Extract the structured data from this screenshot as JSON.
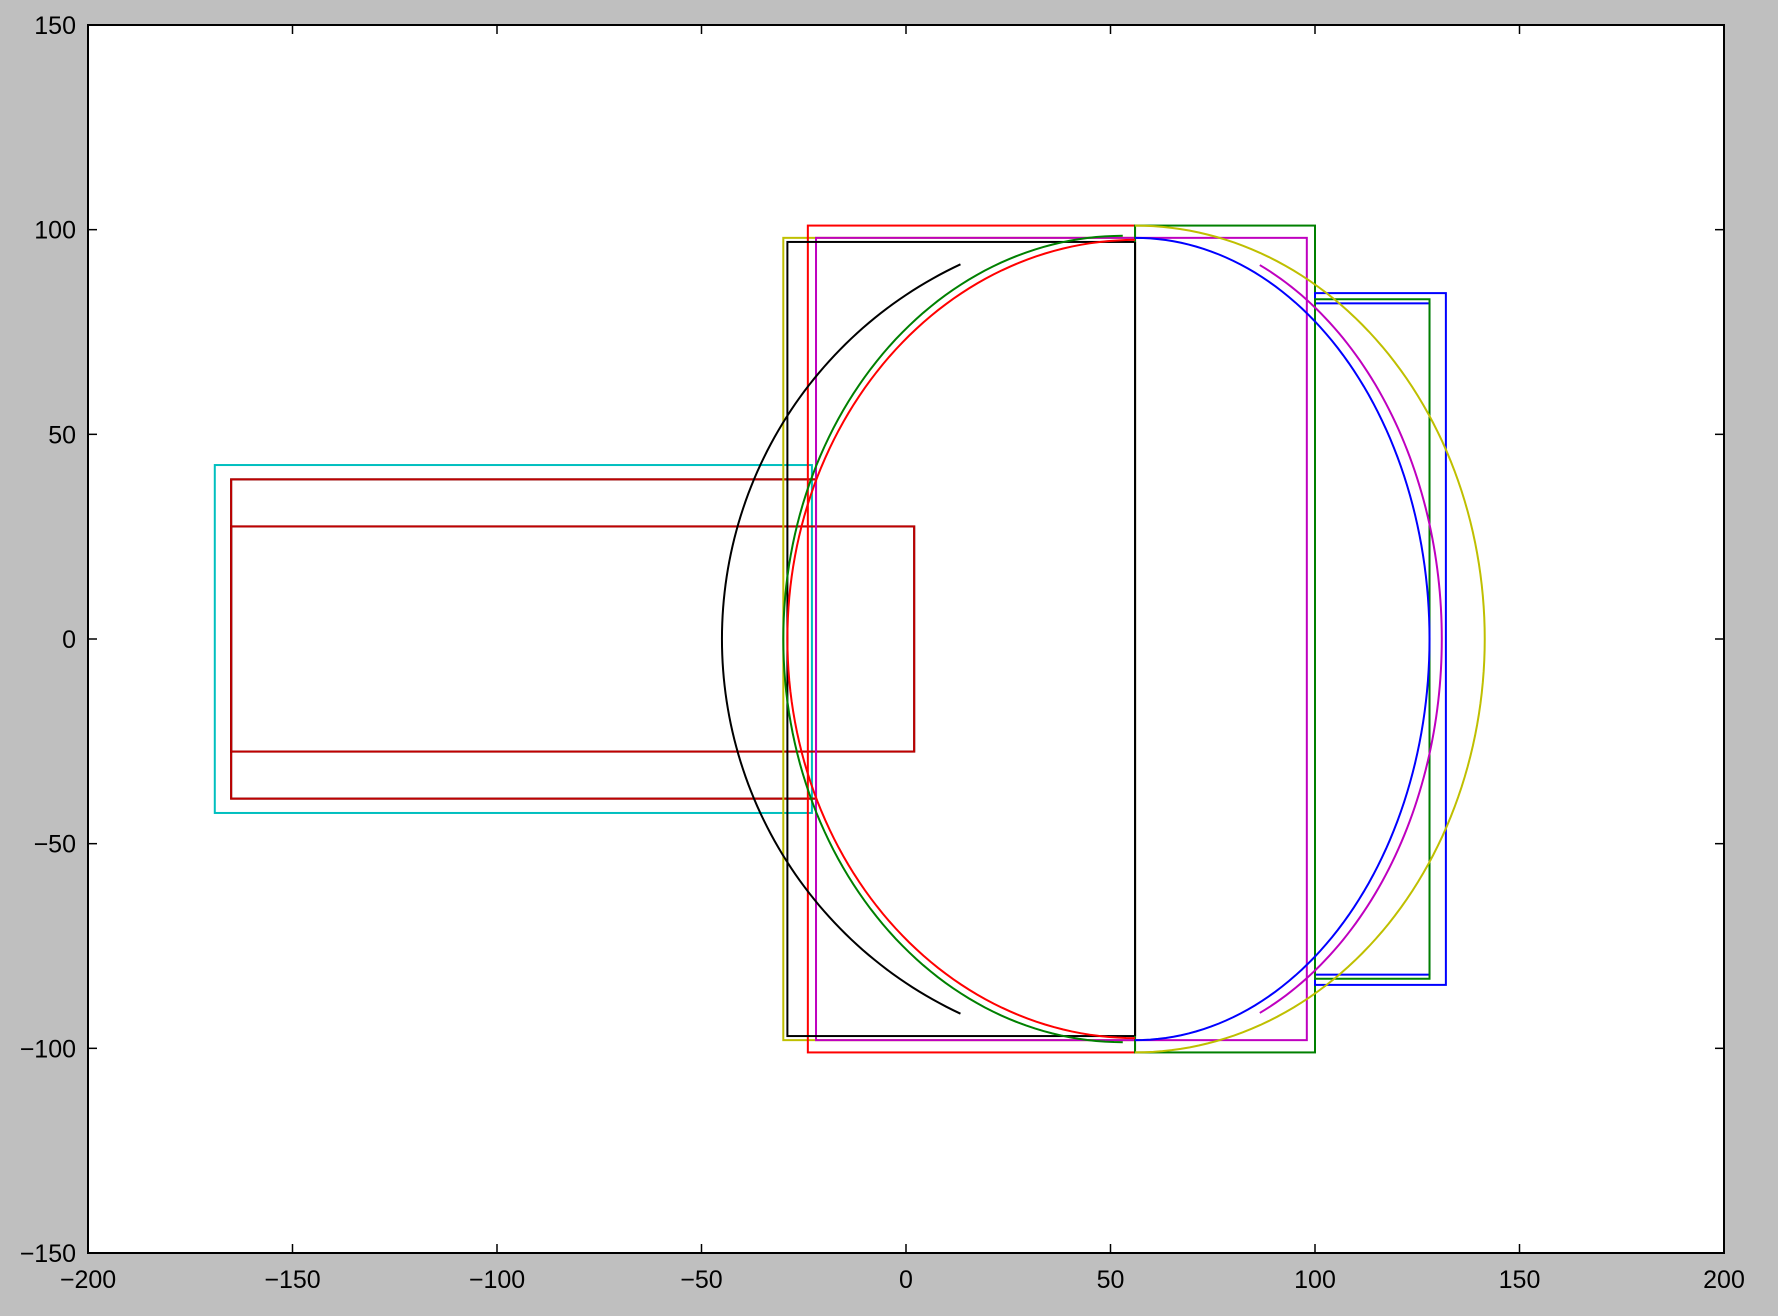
{
  "chart_data": {
    "type": "line",
    "title": "",
    "xlabel": "",
    "ylabel": "",
    "xlim": [
      -200,
      200
    ],
    "ylim": [
      -150,
      150
    ],
    "grid": false,
    "legend": "none",
    "x_ticks": [
      -200,
      -150,
      -100,
      -50,
      0,
      50,
      100,
      150,
      200
    ],
    "y_ticks": [
      -150,
      -100,
      -50,
      0,
      50,
      100,
      150
    ],
    "x_tick_labels": [
      "−200",
      "−150",
      "−100",
      "−50",
      "0",
      "50",
      "100",
      "150",
      "200"
    ],
    "y_tick_labels": [
      "−150",
      "−100",
      "−50",
      "0",
      "50",
      "100",
      "150"
    ],
    "colors": {
      "axes_bg": "#ffffff",
      "figure_bg": "#bfbfbf",
      "spine": "#000000"
    },
    "series": [
      {
        "kind": "rect",
        "color": "#00bfbf",
        "x": [
          -169,
          -23
        ],
        "y": [
          -42.5,
          42.5
        ]
      },
      {
        "kind": "rect",
        "color": "#000000",
        "x": [
          -165,
          -22
        ],
        "y": [
          -39,
          39
        ]
      },
      {
        "kind": "rect",
        "color": "#bf0000",
        "x": [
          -165,
          -22
        ],
        "y": [
          -39,
          39
        ]
      },
      {
        "kind": "rect",
        "color": "#000000",
        "x": [
          -165,
          2
        ],
        "y": [
          -27.5,
          27.5
        ]
      },
      {
        "kind": "rect",
        "color": "#bf0000",
        "x": [
          -165,
          2
        ],
        "y": [
          -27.5,
          27.5
        ]
      },
      {
        "kind": "rect",
        "color": "#bfbf00",
        "x": [
          -30,
          56
        ],
        "y": [
          -98,
          98
        ]
      },
      {
        "kind": "rect",
        "color": "#ff0000",
        "x": [
          -24,
          56
        ],
        "y": [
          -101,
          101
        ]
      },
      {
        "kind": "rect",
        "color": "#bf00bf",
        "x": [
          -22,
          98
        ],
        "y": [
          -98,
          98
        ]
      },
      {
        "kind": "rect",
        "color": "#000000",
        "x": [
          -29,
          56
        ],
        "y": [
          -97,
          97
        ]
      },
      {
        "kind": "rect",
        "color": "#008000",
        "x": [
          56,
          100
        ],
        "y": [
          -101,
          101
        ]
      },
      {
        "kind": "rect",
        "color": "#0000ff",
        "x": [
          100,
          132
        ],
        "y": [
          -84.5,
          84.5
        ]
      },
      {
        "kind": "rect",
        "color": "#0000ff",
        "x": [
          100,
          128
        ],
        "y": [
          -82,
          82
        ]
      },
      {
        "kind": "rect",
        "color": "#008000",
        "x": [
          100,
          128
        ],
        "y": [
          -83,
          83
        ]
      },
      {
        "kind": "segment",
        "color": "#000000",
        "x": [
          56,
          56
        ],
        "y": [
          -97,
          97
        ]
      },
      {
        "kind": "arc",
        "color": "#000000",
        "cx": 56,
        "cy": 0,
        "r": 101,
        "a0": 115,
        "a1": 245
      },
      {
        "kind": "arc",
        "color": "#008000",
        "cx": 53,
        "cy": 0,
        "r": 83,
        "a0": 90,
        "a1": 270,
        "ry": 98.5
      },
      {
        "kind": "arc",
        "color": "#ff0000",
        "cx": 56,
        "cy": 0,
        "r": 85,
        "a0": 90,
        "a1": 270,
        "ry": 97.5
      },
      {
        "kind": "arc",
        "color": "#bfbf00",
        "cx": 56,
        "cy": 0,
        "r": 85.5,
        "a0": -90,
        "a1": 90,
        "ry": 101
      },
      {
        "kind": "arc",
        "color": "#0000ff",
        "cx": 56,
        "cy": 0,
        "r": 72,
        "a0": -90,
        "a1": 90,
        "ry": 98
      },
      {
        "kind": "arc",
        "color": "#bf00bf",
        "cx": 56,
        "cy": 0,
        "r": 75,
        "a0": -66,
        "a1": 66,
        "ry": 100
      }
    ]
  }
}
